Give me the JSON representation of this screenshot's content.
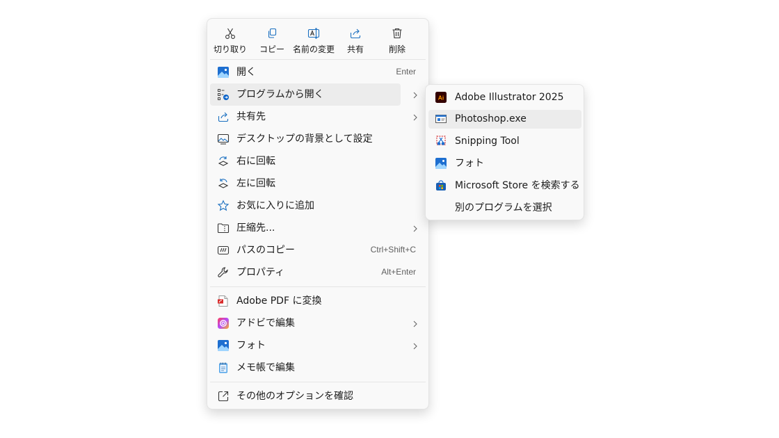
{
  "context_menu": {
    "toolbar": [
      {
        "label": "切り取り",
        "icon": "cut-icon"
      },
      {
        "label": "コピー",
        "icon": "copy-icon"
      },
      {
        "label": "名前の変更",
        "icon": "rename-icon"
      },
      {
        "label": "共有",
        "icon": "share-icon"
      },
      {
        "label": "削除",
        "icon": "delete-icon"
      }
    ],
    "items": [
      {
        "label": "開く",
        "shortcut": "Enter",
        "icon": "photos-app-icon"
      },
      {
        "label": "プログラムから開く",
        "icon": "open-with-icon",
        "has_submenu": true,
        "highlighted": true
      },
      {
        "label": "共有先",
        "icon": "share-to-icon",
        "has_submenu": true
      },
      {
        "label": "デスクトップの背景として設定",
        "icon": "wallpaper-icon"
      },
      {
        "label": "右に回転",
        "icon": "rotate-right-icon"
      },
      {
        "label": "左に回転",
        "icon": "rotate-left-icon"
      },
      {
        "label": "お気に入りに追加",
        "icon": "star-icon"
      },
      {
        "label": "圧縮先...",
        "icon": "zip-folder-icon",
        "has_submenu": true
      },
      {
        "label": "パスのコピー",
        "shortcut": "Ctrl+Shift+C",
        "icon": "copy-path-icon"
      },
      {
        "label": "プロパティ",
        "shortcut": "Alt+Enter",
        "icon": "wrench-icon"
      }
    ],
    "items2": [
      {
        "label": "Adobe PDF に変換",
        "icon": "adobe-pdf-icon"
      },
      {
        "label": "アドビで編集",
        "icon": "adobe-cc-icon",
        "has_submenu": true
      },
      {
        "label": "フォト",
        "icon": "photos-app-icon",
        "has_submenu": true
      },
      {
        "label": "メモ帳で編集",
        "icon": "notepad-icon"
      }
    ],
    "more_options": {
      "label": "その他のオプションを確認",
      "icon": "more-options-icon"
    }
  },
  "open_with_submenu": {
    "items": [
      {
        "label": "Adobe Illustrator 2025",
        "icon": "illustrator-icon",
        "icon_text": "Ai"
      },
      {
        "label": "Photoshop.exe",
        "icon": "photoshop-exe-icon",
        "highlighted": true
      },
      {
        "label": "Snipping Tool",
        "icon": "snipping-tool-icon"
      },
      {
        "label": "フォト",
        "icon": "photos-app-icon"
      },
      {
        "label": "Microsoft Store を検索する",
        "icon": "microsoft-store-icon"
      },
      {
        "label": "別のプログラムを選択",
        "icon": ""
      }
    ]
  },
  "colors": {
    "menu_bg": "#f9f9f9",
    "hover_bg": "#ececec",
    "accent": "#0067c0",
    "illustrator_bg": "#330000",
    "illustrator_fg": "#ff9a00"
  }
}
